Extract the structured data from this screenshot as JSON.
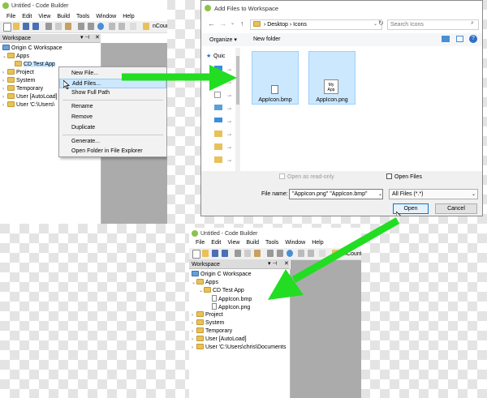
{
  "top_builder": {
    "title": "Untitled - Code Builder",
    "menu": [
      "File",
      "Edit",
      "View",
      "Build",
      "Tools",
      "Window",
      "Help"
    ],
    "toolbar_trailing_text": "nCount",
    "workspace_label": "Workspace",
    "tree": [
      "Origin C Workspace",
      "Apps",
      "CD Test App",
      "Project",
      "System",
      "Temporary",
      "User [AutoLoad]",
      "User 'C:\\Users\\"
    ],
    "context_menu": [
      "New File...",
      "Add Files...",
      "Show Full Path",
      "Rename",
      "Remove",
      "Duplicate",
      "Generate...",
      "Open Folder in File Explorer"
    ]
  },
  "dialog": {
    "title": "Add Files to Workspace",
    "path": [
      "Desktop",
      "Icons"
    ],
    "search_placeholder": "Search Icons",
    "organize_label": "Organize",
    "new_folder_label": "New folder",
    "quick_access_label": "Quic",
    "files": [
      {
        "name": "AppIcon.bmp",
        "thumb_text": ""
      },
      {
        "name": "AppIcon.png",
        "thumb_text": "My App"
      }
    ],
    "open_readonly_label": "Open as read-only",
    "open_files_label": "Open Files",
    "filename_label": "File name:",
    "filename_value": "\"AppIcon.png\" \"AppIcon.bmp\"",
    "filter_value": "All Files (*.*)",
    "open_button": "Open",
    "cancel_button": "Cancel"
  },
  "bottom_builder": {
    "title": "Untitled - Code Builder",
    "menu": [
      "File",
      "Edit",
      "View",
      "Build",
      "Tools",
      "Window",
      "Help"
    ],
    "toolbar_trailing_text": "nCount",
    "workspace_label": "Workspace",
    "tree": [
      "Origin C Workspace",
      "Apps",
      "CD Test App",
      "AppIcon.bmp",
      "AppIcon.png",
      "Project",
      "System",
      "Temporary",
      "User [AutoLoad]",
      "User 'C:\\Users\\chris\\Documents"
    ]
  },
  "colors": {
    "arrow": "#22dd22",
    "selection": "#cce8ff",
    "folder": "#e9c15a"
  }
}
